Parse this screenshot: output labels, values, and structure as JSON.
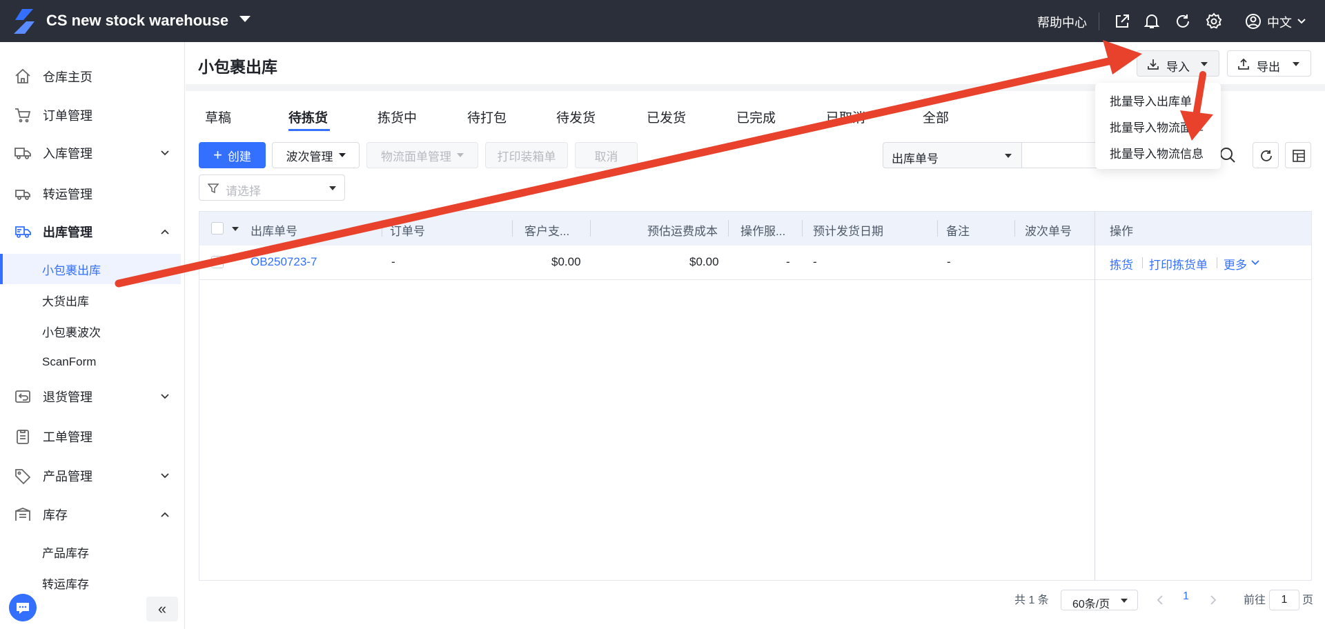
{
  "topbar": {
    "warehouse_name": "CS new stock warehouse",
    "help_label": "帮助中心",
    "language_label": "中文"
  },
  "sidebar": {
    "items": [
      {
        "label": "仓库主页",
        "icon": "home-icon"
      },
      {
        "label": "订单管理",
        "icon": "cart-icon"
      },
      {
        "label": "入库管理",
        "icon": "truck-icon"
      },
      {
        "label": "转运管理",
        "icon": "transfer-truck-icon"
      },
      {
        "label": "出库管理",
        "icon": "outbound-icon"
      },
      {
        "label": "退货管理",
        "icon": "return-icon"
      },
      {
        "label": "工单管理",
        "icon": "clipboard-icon"
      },
      {
        "label": "产品管理",
        "icon": "tag-icon"
      },
      {
        "label": "库存",
        "icon": "warehouse-icon"
      }
    ],
    "outbound_sub": [
      "小包裹出库",
      "大货出库",
      "小包裹波次",
      "ScanForm"
    ],
    "stock_sub": [
      "产品库存",
      "转运库存"
    ],
    "collapse_label": "«"
  },
  "page": {
    "title": "小包裹出库",
    "import_label": "导入",
    "export_label": "导出",
    "import_menu": [
      "批量导入出库单",
      "批量导入物流面单",
      "批量导入物流信息"
    ]
  },
  "tabs": [
    "草稿",
    "待拣货",
    "拣货中",
    "待打包",
    "待发货",
    "已发货",
    "已完成",
    "已取消",
    "全部"
  ],
  "toolbar": {
    "create_label": "创建",
    "wave_label": "波次管理",
    "label_mgmt": "物流面单管理",
    "print_box": "打印装箱单",
    "cancel": "取消",
    "search_field": "出库单号",
    "filter_placeholder": "请选择"
  },
  "table": {
    "headers": [
      "出库单号",
      "订单号",
      "客户支...",
      "预估运费成本",
      "操作服...",
      "预计发货日期",
      "备注",
      "波次单号",
      "操作"
    ],
    "rows": [
      {
        "outbound_no": "OB250723-7",
        "order_no": "-",
        "customer_pay": "$0.00",
        "est_cost": "$0.00",
        "op_service": "-",
        "ship_date": "-",
        "note": "-",
        "actions": [
          "拣货",
          "打印拣货单",
          "更多"
        ]
      }
    ]
  },
  "pagination": {
    "total": "共 1 条",
    "page_size": "60条/页",
    "current": "1",
    "goto_label": "前往",
    "goto_value": "1",
    "page_suffix": "页"
  },
  "colors": {
    "accent": "#3370ff",
    "topbar": "#2b2f3a",
    "annotation_arrow": "#e8412c"
  }
}
